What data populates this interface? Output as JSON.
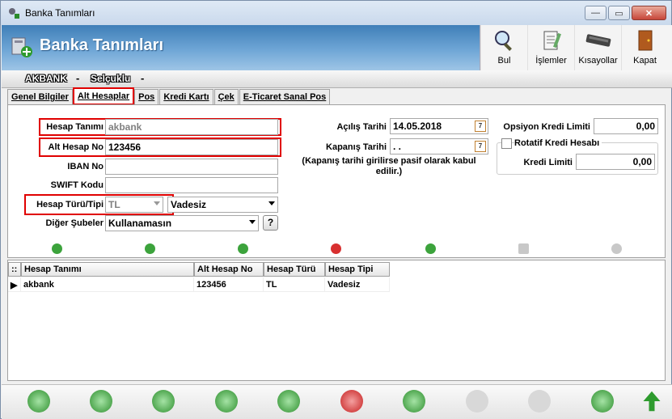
{
  "window": {
    "title": "Banka Tanımları"
  },
  "header": {
    "title": "Banka Tanımları"
  },
  "toolbar": [
    {
      "label": "Bul",
      "icon": "magnifier-icon"
    },
    {
      "label": "İşlemler",
      "icon": "clipboard-icon"
    },
    {
      "label": "Kısayollar",
      "icon": "keyboard-icon"
    },
    {
      "label": "Kapat",
      "icon": "exit-door-icon"
    }
  ],
  "bank": {
    "name": "AKBANK",
    "branch": "Selçuklu",
    "sep1": "-",
    "sep2": "-"
  },
  "tabs": [
    "Genel Bilgiler",
    "Alt Hesaplar",
    "Pos",
    "Kredi Kartı",
    "Çek",
    "E-Ticaret Sanal Pos"
  ],
  "form": {
    "hesap_tanimi_label": "Hesap Tanımı",
    "hesap_tanimi_value": "akbank",
    "alt_hesap_no_label": "Alt Hesap No",
    "alt_hesap_no_value": "123456",
    "iban_label": "IBAN No",
    "iban_value": "",
    "swift_label": "SWIFT Kodu",
    "swift_value": "",
    "hesap_turu_label": "Hesap Türü/Tipi",
    "hesap_turu_value": "TL",
    "hesap_tipi_value": "Vadesiz",
    "diger_subeler_label": "Diğer Şubeler",
    "diger_subeler_value": "Kullanamasın",
    "help_button": "?",
    "acilis_label": "Açılış Tarihi",
    "acilis_value": "14.05.2018",
    "kapanis_label": "Kapanış Tarihi",
    "kapanis_value": " . .",
    "kapanis_note": "(Kapanış tarihi girilirse pasif olarak kabul edilir.)",
    "opsiyon_label": "Opsiyon Kredi Limiti",
    "opsiyon_value": "0,00",
    "rotatif_label": "Rotatif Kredi Hesabı",
    "kredi_limiti_label": "Kredi Limiti",
    "kredi_limiti_value": "0,00"
  },
  "grid": {
    "columns": [
      "Hesap Tanımı",
      "Alt Hesap No",
      "Hesap Türü",
      "Hesap Tipi"
    ],
    "rows": [
      [
        "akbank",
        "123456",
        "TL",
        "Vadesiz"
      ]
    ]
  },
  "colors": {
    "header_blue": "#3f7fb8",
    "highlight_red": "#e00000"
  }
}
